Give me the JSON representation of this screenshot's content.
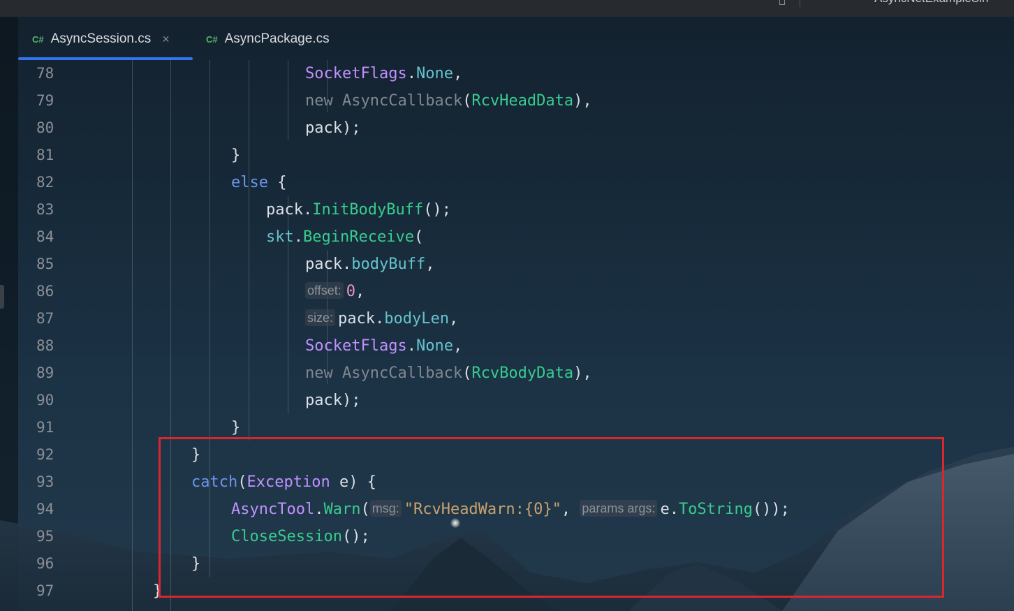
{
  "window": {
    "title": "AsyncNetExampleSln"
  },
  "tabs": [
    {
      "lang": "C#",
      "label": "AsyncSession.cs",
      "active": true,
      "close": "×"
    },
    {
      "lang": "C#",
      "label": "AsyncPackage.cs",
      "active": false
    }
  ],
  "lines": [
    {
      "n": "78",
      "tokens": [
        [
          "SocketFlags",
          "t-type"
        ],
        [
          ".",
          "t-ident"
        ],
        [
          "None",
          "t-member"
        ],
        [
          ",",
          "t-ident"
        ]
      ]
    },
    {
      "n": "79",
      "tokens": [
        [
          "new ",
          "t-dim"
        ],
        [
          "AsyncCallback",
          "t-dim"
        ],
        [
          "(",
          "t-ident"
        ],
        [
          "RcvHeadData",
          "t-method"
        ],
        [
          ")",
          "t-ident"
        ],
        [
          ",",
          "t-ident"
        ]
      ]
    },
    {
      "n": "80",
      "tokens": [
        [
          "pack",
          "t-ident"
        ],
        [
          ");",
          "t-ident"
        ]
      ]
    },
    {
      "n": "81",
      "tokens": [
        [
          "}",
          "t-ident"
        ]
      ]
    },
    {
      "n": "82",
      "tokens": [
        [
          "else",
          "t-kw"
        ],
        [
          " {",
          "t-ident"
        ]
      ]
    },
    {
      "n": "83",
      "tokens": [
        [
          "pack",
          "t-ident"
        ],
        [
          ".",
          "t-ident"
        ],
        [
          "InitBodyBuff",
          "t-method"
        ],
        [
          "();",
          "t-ident"
        ]
      ]
    },
    {
      "n": "84",
      "tokens": [
        [
          "skt",
          "t-local"
        ],
        [
          ".",
          "t-ident"
        ],
        [
          "BeginReceive",
          "t-method"
        ],
        [
          "(",
          "t-ident"
        ]
      ]
    },
    {
      "n": "85",
      "tokens": [
        [
          "pack",
          "t-ident"
        ],
        [
          ".",
          "t-ident"
        ],
        [
          "bodyBuff",
          "t-member"
        ],
        [
          ",",
          "t-ident"
        ]
      ]
    },
    {
      "n": "86",
      "tokens": [
        [
          "offset:",
          "hint"
        ],
        [
          "0",
          "t-num"
        ],
        [
          ",",
          "t-ident"
        ]
      ]
    },
    {
      "n": "87",
      "tokens": [
        [
          "size:",
          "hint"
        ],
        [
          "pack",
          "t-ident"
        ],
        [
          ".",
          "t-ident"
        ],
        [
          "bodyLen",
          "t-member"
        ],
        [
          ",",
          "t-ident"
        ]
      ]
    },
    {
      "n": "88",
      "tokens": [
        [
          "SocketFlags",
          "t-type"
        ],
        [
          ".",
          "t-ident"
        ],
        [
          "None",
          "t-member"
        ],
        [
          ",",
          "t-ident"
        ]
      ]
    },
    {
      "n": "89",
      "tokens": [
        [
          "new ",
          "t-dim"
        ],
        [
          "AsyncCallback",
          "t-dim"
        ],
        [
          "(",
          "t-ident"
        ],
        [
          "RcvBodyData",
          "t-method"
        ],
        [
          ")",
          "t-ident"
        ],
        [
          ",",
          "t-ident"
        ]
      ]
    },
    {
      "n": "90",
      "tokens": [
        [
          "pack",
          "t-ident"
        ],
        [
          ");",
          "t-ident"
        ]
      ]
    },
    {
      "n": "91",
      "tokens": [
        [
          "}",
          "t-ident"
        ]
      ]
    },
    {
      "n": "92",
      "tokens": [
        [
          "}",
          "t-ident"
        ]
      ]
    },
    {
      "n": "93",
      "tokens": [
        [
          "catch",
          "t-kw"
        ],
        [
          "(",
          "t-ident"
        ],
        [
          "Exception",
          "t-type"
        ],
        [
          " e) {",
          "t-ident"
        ]
      ]
    },
    {
      "n": "94",
      "tokens": [
        [
          "AsyncTool",
          "t-type"
        ],
        [
          ".",
          "t-ident"
        ],
        [
          "Warn",
          "t-method"
        ],
        [
          "(",
          "t-ident"
        ],
        [
          "msg:",
          "hint"
        ],
        [
          "\"RcvHeadWarn:{0}\"",
          "t-str"
        ],
        [
          ", ",
          "t-ident"
        ],
        [
          "params args:",
          "hint"
        ],
        [
          "e",
          "t-ident"
        ],
        [
          ".",
          "t-ident"
        ],
        [
          "ToString",
          "t-method"
        ],
        [
          "());",
          "t-ident"
        ]
      ]
    },
    {
      "n": "95",
      "tokens": [
        [
          "CloseSession",
          "t-method"
        ],
        [
          "();",
          "t-ident"
        ]
      ]
    },
    {
      "n": "96",
      "tokens": [
        [
          "}",
          "t-ident"
        ]
      ]
    },
    {
      "n": "97",
      "tokens": [
        [
          "}",
          "t-ident"
        ]
      ]
    }
  ]
}
